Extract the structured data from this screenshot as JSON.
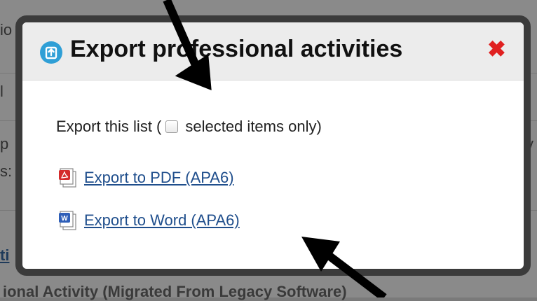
{
  "background": {
    "fragments": [
      "io",
      "l",
      "p",
      "s:",
      "ti",
      "ional Activity (Migrated From Legacy Software)",
      "v"
    ]
  },
  "dialog": {
    "title": "Export professional activities",
    "icon": "export-icon",
    "close_icon": "close-icon",
    "export_scope": {
      "prefix": "Export this list (",
      "checkbox_label": "selected items only)",
      "checked": false
    },
    "links": [
      {
        "label": "Export to PDF (APA6)",
        "icon": "pdf-file-icon"
      },
      {
        "label": "Export to Word (APA6)",
        "icon": "word-file-icon"
      }
    ]
  },
  "colors": {
    "accent": "#2f9fd6",
    "close": "#e02020",
    "link": "#1f4e8c",
    "dialog_border": "#3b3b3b"
  }
}
